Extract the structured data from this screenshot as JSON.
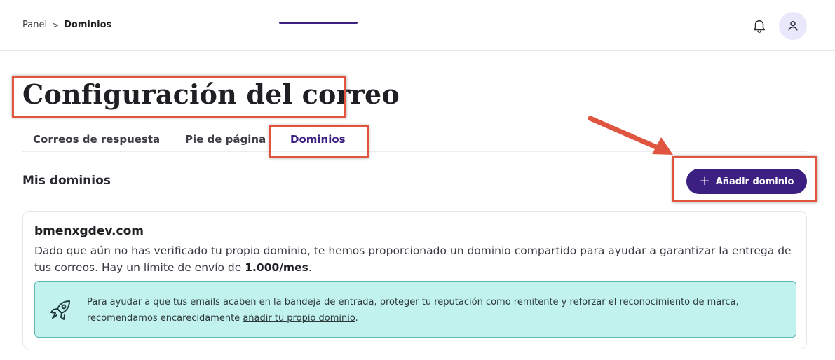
{
  "breadcrumb": {
    "parent": "Panel",
    "separator": ">",
    "current": "Dominios"
  },
  "header": {
    "title": "Configuración del correo"
  },
  "tabs": [
    {
      "label": "Correos de respuesta",
      "active": false
    },
    {
      "label": "Pie de página",
      "active": false
    },
    {
      "label": "Dominios",
      "active": true
    }
  ],
  "section": {
    "title": "Mis dominios",
    "add_button_label": "Añadir dominio",
    "add_button_icon": "+"
  },
  "domain": {
    "name": "bmenxgdev.com",
    "description_before": "Dado que aún no has verificado tu propio dominio, te hemos proporcionado un dominio compartido para ayudar a garantizar la entrega de tus correos. Hay un límite de envío de ",
    "limit": "1.000/mes",
    "description_after": "."
  },
  "info": {
    "text_before": "Para ayudar a que tus emails acaben en la bandeja de entrada, proteger tu reputación como remitente y reforzar el reconocimiento de marca, recomendamos encarecidamente ",
    "link": "añadir tu propio dominio",
    "text_after": "."
  },
  "icons": {
    "bell": "bell-icon",
    "user": "user-icon",
    "rocket": "rocket-icon",
    "plus": "plus-icon"
  },
  "colors": {
    "primary": "#3b2082",
    "highlight": "#e0553f",
    "info_bg": "#c2f2ee",
    "info_border": "#5fb8b0",
    "avatar_bg": "#e9e7fb"
  }
}
